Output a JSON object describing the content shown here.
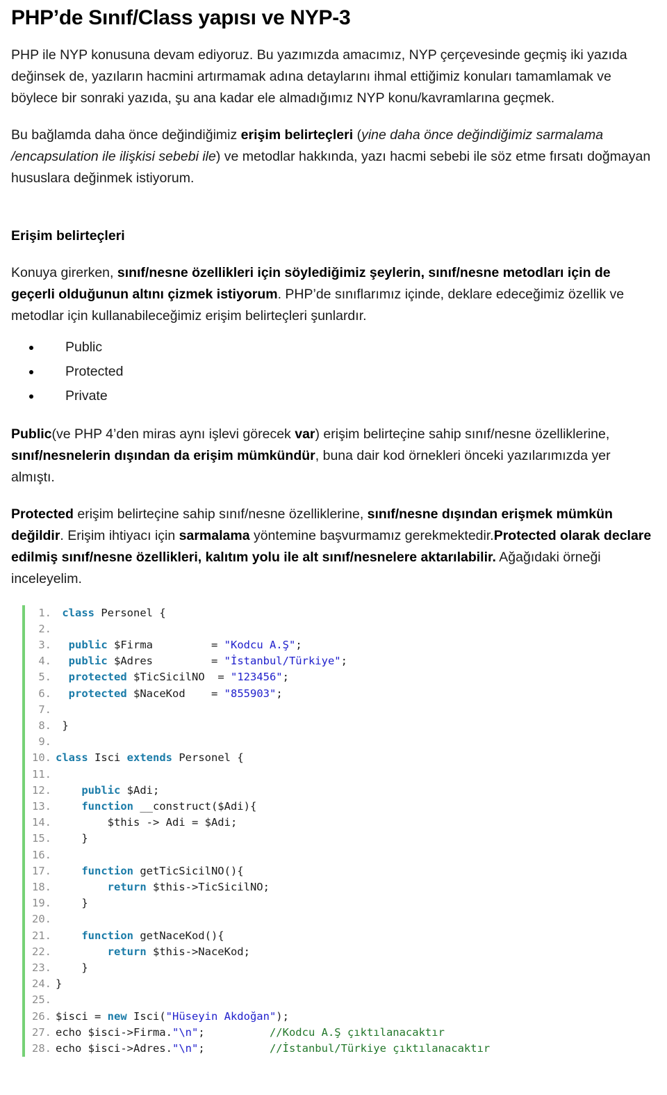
{
  "document": {
    "title": "PHP’de Sınıf/Class yapısı ve NYP-3",
    "paragraph1_html": "PHP ile NYP konusuna devam ediyoruz. Bu yazımızda amacımız, NYP çerçevesinde geçmiş iki yazıda değinsek de, yazıların hacmini artırmamak adına detaylarını ihmal ettiğimiz konuları tamamlamak ve böylece bir sonraki yazıda, şu ana kadar ele almadığımız NYP konu/kavramlarına geçmek.",
    "paragraph2_html": "Bu  bağlamda daha önce değindiğimiz <b>erişim belirteçleri</b> (<i>yine daha önce değindiğimiz sarmalama /encapsulation ile ilişkisi sebebi ile</i>) ve metodlar hakkında, yazı hacmi sebebi ile söz etme fırsatı doğmayan hususlara değinmek istiyorum.",
    "section_heading": "Erişim belirteçleri",
    "paragraph3_html": "Konuya girerken, <b>sınıf/nesne özellikleri için söylediğimiz şeylerin, sınıf/nesne metodları için de geçerli olduğunun altını çizmek istiyorum</b>. PHP’de sınıflarımız içinde, deklare edeceğimiz özellik ve metodlar için kullanabileceğimiz erişim belirteçleri şunlardır.",
    "bullets": [
      "Public",
      "Protected",
      "Private"
    ],
    "paragraph4_html": "<b>Public</b>(ve PHP 4’den miras aynı işlevi görecek <b>var</b>) erişim belirteçine sahip sınıf/nesne özelliklerine, <b>sınıf/nesnelerin dışından da erişim mümkündür</b>, buna dair kod örnekleri önceki yazılarımızda yer almıştı.",
    "paragraph5_html": "<b>Protected</b> erişim belirteçine sahip sınıf/nesne özelliklerine, <b>sınıf/nesne dışından erişmek mümkün değildir</b>. Erişim ihtiyacı için <b>sarmalama</b> yöntemine başvurmamız gerekmektedir.<b>Protected olarak declare edilmiş sınıf/nesne özellikleri, kalıtım yolu ile alt sınıf/nesnelere aktarılabilir.</b> Ağağıdaki örneği inceleyelim."
  },
  "code": {
    "language": "php",
    "accent_color": "#76d176",
    "keyword_color": "#1a7ba8",
    "string_color": "#2020cc",
    "comment_color": "#22772a",
    "linenumber_color": "#8c8c8c",
    "lines": [
      {
        "n": "1.",
        "tokens": [
          {
            "t": " ",
            "c": "pl"
          },
          {
            "t": "class",
            "c": "k"
          },
          {
            "t": " Personel {",
            "c": "pl"
          }
        ]
      },
      {
        "n": "2.",
        "tokens": []
      },
      {
        "n": "3.",
        "tokens": [
          {
            "t": "  ",
            "c": "pl"
          },
          {
            "t": "public",
            "c": "k"
          },
          {
            "t": " $Firma         = ",
            "c": "pl"
          },
          {
            "t": "\"Kodcu A.Ş\"",
            "c": "s"
          },
          {
            "t": ";",
            "c": "pl"
          }
        ]
      },
      {
        "n": "4.",
        "tokens": [
          {
            "t": "  ",
            "c": "pl"
          },
          {
            "t": "public",
            "c": "k"
          },
          {
            "t": " $Adres         = ",
            "c": "pl"
          },
          {
            "t": "\"İstanbul/Türkiye\"",
            "c": "s"
          },
          {
            "t": ";",
            "c": "pl"
          }
        ]
      },
      {
        "n": "5.",
        "tokens": [
          {
            "t": "  ",
            "c": "pl"
          },
          {
            "t": "protected",
            "c": "k"
          },
          {
            "t": " $TicSicilNO  = ",
            "c": "pl"
          },
          {
            "t": "\"123456\"",
            "c": "s"
          },
          {
            "t": ";",
            "c": "pl"
          }
        ]
      },
      {
        "n": "6.",
        "tokens": [
          {
            "t": "  ",
            "c": "pl"
          },
          {
            "t": "protected",
            "c": "k"
          },
          {
            "t": " $NaceKod    = ",
            "c": "pl"
          },
          {
            "t": "\"855903\"",
            "c": "s"
          },
          {
            "t": ";",
            "c": "pl"
          }
        ]
      },
      {
        "n": "7.",
        "tokens": []
      },
      {
        "n": "8.",
        "tokens": [
          {
            "t": " }",
            "c": "pl"
          }
        ]
      },
      {
        "n": "9.",
        "tokens": []
      },
      {
        "n": "10.",
        "tokens": [
          {
            "t": "class",
            "c": "k"
          },
          {
            "t": " Isci ",
            "c": "pl"
          },
          {
            "t": "extends",
            "c": "k"
          },
          {
            "t": " Personel {",
            "c": "pl"
          }
        ]
      },
      {
        "n": "11.",
        "tokens": []
      },
      {
        "n": "12.",
        "tokens": [
          {
            "t": "    ",
            "c": "pl"
          },
          {
            "t": "public",
            "c": "k"
          },
          {
            "t": " $Adi;",
            "c": "pl"
          }
        ]
      },
      {
        "n": "13.",
        "tokens": [
          {
            "t": "    ",
            "c": "pl"
          },
          {
            "t": "function",
            "c": "k"
          },
          {
            "t": " __construct($Adi){",
            "c": "pl"
          }
        ]
      },
      {
        "n": "14.",
        "tokens": [
          {
            "t": "        $this -> Adi = $Adi;",
            "c": "pl"
          }
        ]
      },
      {
        "n": "15.",
        "tokens": [
          {
            "t": "    }",
            "c": "pl"
          }
        ]
      },
      {
        "n": "16.",
        "tokens": []
      },
      {
        "n": "17.",
        "tokens": [
          {
            "t": "    ",
            "c": "pl"
          },
          {
            "t": "function",
            "c": "k"
          },
          {
            "t": " getTicSicilNO(){",
            "c": "pl"
          }
        ]
      },
      {
        "n": "18.",
        "tokens": [
          {
            "t": "        ",
            "c": "pl"
          },
          {
            "t": "return",
            "c": "k"
          },
          {
            "t": " $this->TicSicilNO;",
            "c": "pl"
          }
        ]
      },
      {
        "n": "19.",
        "tokens": [
          {
            "t": "    }",
            "c": "pl"
          }
        ]
      },
      {
        "n": "20.",
        "tokens": []
      },
      {
        "n": "21.",
        "tokens": [
          {
            "t": "    ",
            "c": "pl"
          },
          {
            "t": "function",
            "c": "k"
          },
          {
            "t": " getNaceKod(){",
            "c": "pl"
          }
        ]
      },
      {
        "n": "22.",
        "tokens": [
          {
            "t": "        ",
            "c": "pl"
          },
          {
            "t": "return",
            "c": "k"
          },
          {
            "t": " $this->NaceKod;",
            "c": "pl"
          }
        ]
      },
      {
        "n": "23.",
        "tokens": [
          {
            "t": "    }",
            "c": "pl"
          }
        ]
      },
      {
        "n": "24.",
        "tokens": [
          {
            "t": "}",
            "c": "pl"
          }
        ]
      },
      {
        "n": "25.",
        "tokens": []
      },
      {
        "n": "26.",
        "tokens": [
          {
            "t": "$isci = ",
            "c": "pl"
          },
          {
            "t": "new",
            "c": "k"
          },
          {
            "t": " Isci(",
            "c": "pl"
          },
          {
            "t": "\"Hüseyin Akdoğan\"",
            "c": "s"
          },
          {
            "t": ");",
            "c": "pl"
          }
        ]
      },
      {
        "n": "27.",
        "tokens": [
          {
            "t": "echo $isci->Firma.",
            "c": "pl"
          },
          {
            "t": "\"\\n\"",
            "c": "s"
          },
          {
            "t": ";          ",
            "c": "pl"
          },
          {
            "t": "//Kodcu A.Ş çıktılanacaktır",
            "c": "cm"
          }
        ]
      },
      {
        "n": "28.",
        "tokens": [
          {
            "t": "echo $isci->Adres.",
            "c": "pl"
          },
          {
            "t": "\"\\n\"",
            "c": "s"
          },
          {
            "t": ";          ",
            "c": "pl"
          },
          {
            "t": "//İstanbul/Türkiye çıktılanacaktır",
            "c": "cm"
          }
        ]
      }
    ]
  }
}
